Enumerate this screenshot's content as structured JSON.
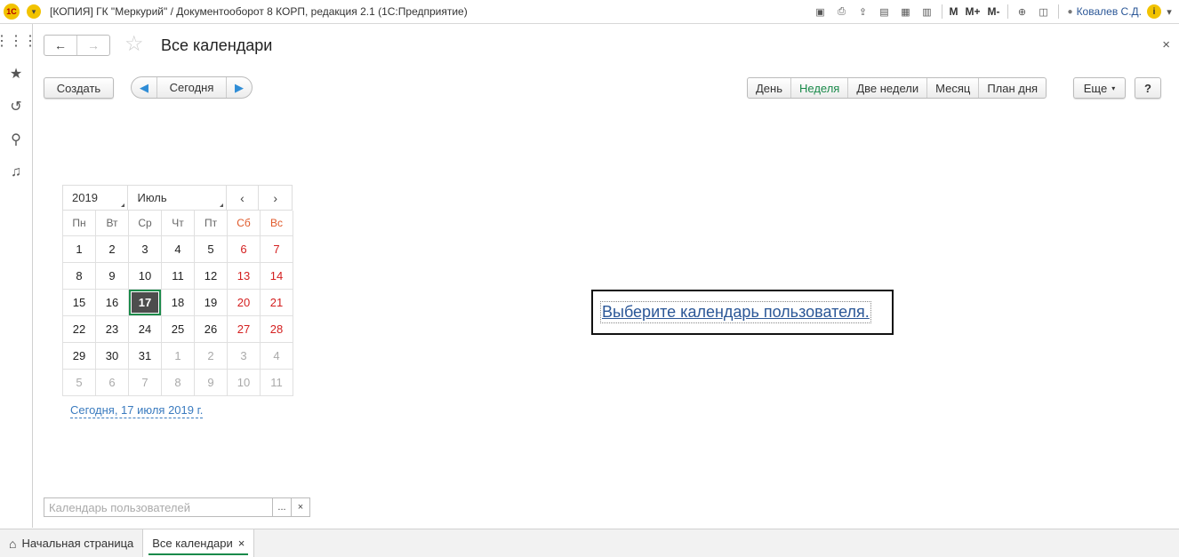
{
  "titlebar": {
    "logo": "1С",
    "title": "[КОПИЯ] ГК \"Меркурий\" / Документооборот 8 КОРП, редакция 2.1   (1С:Предприятие)",
    "m": "M",
    "m_plus": "M+",
    "m_minus": "M-",
    "user": "Ковалев С.Д."
  },
  "header": {
    "title": "Все календари",
    "close": "×"
  },
  "toolbar": {
    "create": "Создать",
    "today": "Сегодня",
    "views": [
      "День",
      "Неделя",
      "Две недели",
      "Месяц",
      "План дня"
    ],
    "active_view": "Неделя",
    "more": "Еще",
    "help": "?"
  },
  "calendar": {
    "year": "2019",
    "month": "Июль",
    "prev": "‹",
    "next": "›",
    "weekdays": [
      "Пн",
      "Вт",
      "Ср",
      "Чт",
      "Пт",
      "Сб",
      "Вс"
    ],
    "days": [
      [
        "1",
        "2",
        "3",
        "4",
        "5",
        "6",
        "7"
      ],
      [
        "8",
        "9",
        "10",
        "11",
        "12",
        "13",
        "14"
      ],
      [
        "15",
        "16",
        "17",
        "18",
        "19",
        "20",
        "21"
      ],
      [
        "22",
        "23",
        "24",
        "25",
        "26",
        "27",
        "28"
      ],
      [
        "29",
        "30",
        "31",
        "1",
        "2",
        "3",
        "4"
      ],
      [
        "5",
        "6",
        "7",
        "8",
        "9",
        "10",
        "11"
      ]
    ],
    "selected": "17",
    "today_link": "Сегодня, 17 июля 2019 г."
  },
  "main": {
    "prompt": "Выберите календарь пользователя."
  },
  "filter": {
    "placeholder": "Календарь пользователей",
    "choose": "...",
    "clear": "×"
  },
  "tabs": [
    {
      "label": "Начальная страница"
    },
    {
      "label": "Все календари",
      "close": "×"
    }
  ],
  "colors": {
    "accent": "#1a8a4a",
    "link": "#2b5797",
    "weekend": "#d42020"
  }
}
